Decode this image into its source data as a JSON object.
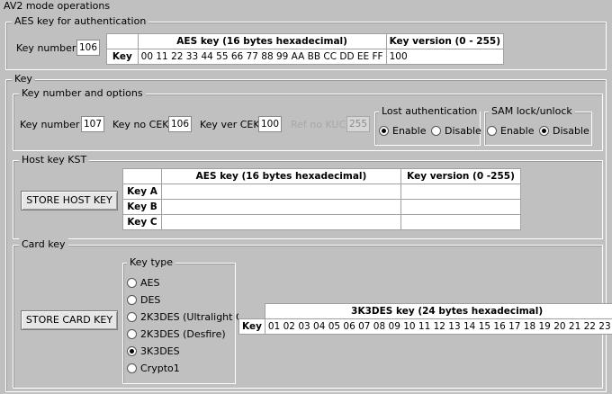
{
  "top_title": "AV2 mode operations",
  "auth": {
    "group_title": "AES key for authentication",
    "key_number_label": "Key number",
    "key_number_value": "106",
    "table": {
      "headers": [
        "",
        "AES key (16 bytes hexadecimal)",
        "Key version (0 - 255)"
      ],
      "row_label": "Key",
      "aes": "00 11 22 33 44 55 66 77 88 99 AA BB CC DD EE FF",
      "version": "100"
    }
  },
  "key": {
    "group_title": "Key",
    "options": {
      "group_title": "Key number and options",
      "key_number_label": "Key number",
      "key_number_value": "107",
      "key_no_cek_label": "Key no CEK",
      "key_no_cek_value": "106",
      "key_ver_cek_label": "Key ver CEK",
      "key_ver_cek_value": "100",
      "ref_no_kuc_label": "Ref no KUC",
      "ref_no_kuc_value": "255",
      "lost_auth": {
        "title": "Lost authentication",
        "enable": "Enable",
        "disable": "Disable",
        "selected": "enable"
      },
      "sam_lock": {
        "title": "SAM lock/unlock",
        "enable": "Enable",
        "disable": "Disable",
        "selected": "disable"
      }
    }
  },
  "host_key": {
    "group_title": "Host key KST",
    "button": "STORE HOST KEY",
    "table": {
      "headers": [
        "",
        "AES key (16 bytes hexadecimal)",
        "Key version (0 -255)"
      ],
      "rows": [
        {
          "label": "Key A",
          "aes": "",
          "version": ""
        },
        {
          "label": "Key B",
          "aes": "",
          "version": ""
        },
        {
          "label": "Key C",
          "aes": "",
          "version": ""
        }
      ]
    }
  },
  "card_key": {
    "group_title": "Card key",
    "button": "STORE CARD KEY",
    "key_type": {
      "title": "Key type",
      "options": [
        "AES",
        "DES",
        "2K3DES (Ultralight C)",
        "2K3DES (Desfire)",
        "3K3DES",
        "Crypto1"
      ],
      "selected": "3K3DES"
    },
    "table": {
      "header": "3K3DES key (24 bytes hexadecimal)",
      "row_label": "Key",
      "value": "01 02 03 04 05 06 07 08 09 10 11 12 13 14 15 16 17 18 19 20 21 22 23 24"
    }
  }
}
